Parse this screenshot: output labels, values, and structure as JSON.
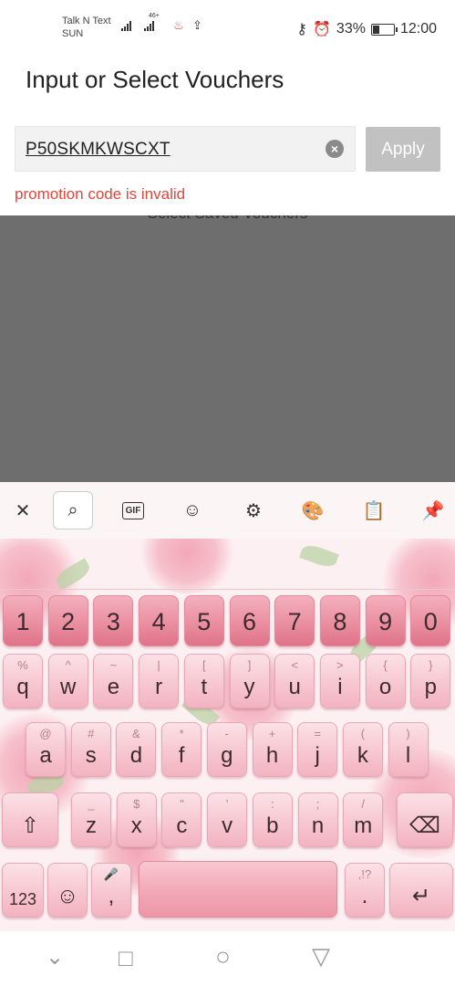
{
  "status_bar": {
    "carrier_line1": "Talk N Text",
    "carrier_line2": "SUN",
    "network": "46+",
    "battery": "33%",
    "battery_level": 0.33,
    "time": "12:00"
  },
  "page": {
    "title": "Input or Select Vouchers",
    "voucher_input": {
      "value": "P50SKMKWSCXT"
    },
    "apply_label": "Apply",
    "error_message": "promotion code is invalid",
    "saved_vouchers_label": "Select Saved Vouchers"
  },
  "keyboard": {
    "toolbar": [
      {
        "name": "close-icon",
        "glyph": "✕"
      },
      {
        "name": "search-icon",
        "glyph": "⌕"
      },
      {
        "name": "gif-icon",
        "glyph": "GIF"
      },
      {
        "name": "sticker-icon",
        "glyph": "☺"
      },
      {
        "name": "settings-icon",
        "glyph": "⚙"
      },
      {
        "name": "theme-palette-icon",
        "glyph": "🎨"
      },
      {
        "name": "clipboard-icon",
        "glyph": "📋"
      },
      {
        "name": "pin-icon",
        "glyph": "📌"
      }
    ],
    "number_row": [
      "1",
      "2",
      "3",
      "4",
      "5",
      "6",
      "7",
      "8",
      "9",
      "0"
    ],
    "row1": [
      {
        "main": "q",
        "sub": "%"
      },
      {
        "main": "w",
        "sub": "^"
      },
      {
        "main": "e",
        "sub": "~"
      },
      {
        "main": "r",
        "sub": "|"
      },
      {
        "main": "t",
        "sub": "["
      },
      {
        "main": "y",
        "sub": "]"
      },
      {
        "main": "u",
        "sub": "<"
      },
      {
        "main": "i",
        "sub": ">"
      },
      {
        "main": "o",
        "sub": "{"
      },
      {
        "main": "p",
        "sub": "}"
      }
    ],
    "row2": [
      {
        "main": "a",
        "sub": "@"
      },
      {
        "main": "s",
        "sub": "#"
      },
      {
        "main": "d",
        "sub": "&"
      },
      {
        "main": "f",
        "sub": "*"
      },
      {
        "main": "g",
        "sub": "-"
      },
      {
        "main": "h",
        "sub": "+"
      },
      {
        "main": "j",
        "sub": "="
      },
      {
        "main": "k",
        "sub": "("
      },
      {
        "main": "l",
        "sub": ")"
      }
    ],
    "row3": [
      {
        "main": "z",
        "sub": "_"
      },
      {
        "main": "x",
        "sub": "$"
      },
      {
        "main": "c",
        "sub": "\""
      },
      {
        "main": "v",
        "sub": "'"
      },
      {
        "main": "b",
        "sub": ":"
      },
      {
        "main": "n",
        "sub": ";"
      },
      {
        "main": "m",
        "sub": "/"
      }
    ],
    "shift_glyph": "⇧",
    "backspace_glyph": "⌫",
    "symbols_label": "123",
    "emoji_glyph": "☺",
    "comma_label": ",",
    "mic_glyph": "🎤",
    "period_label": ".",
    "period_sub": ",!?",
    "enter_glyph": "↵"
  },
  "nav_bar": {
    "back_glyph": "▽",
    "home_glyph": "○",
    "recents_glyph": "□",
    "hide_glyph": "⌄"
  }
}
